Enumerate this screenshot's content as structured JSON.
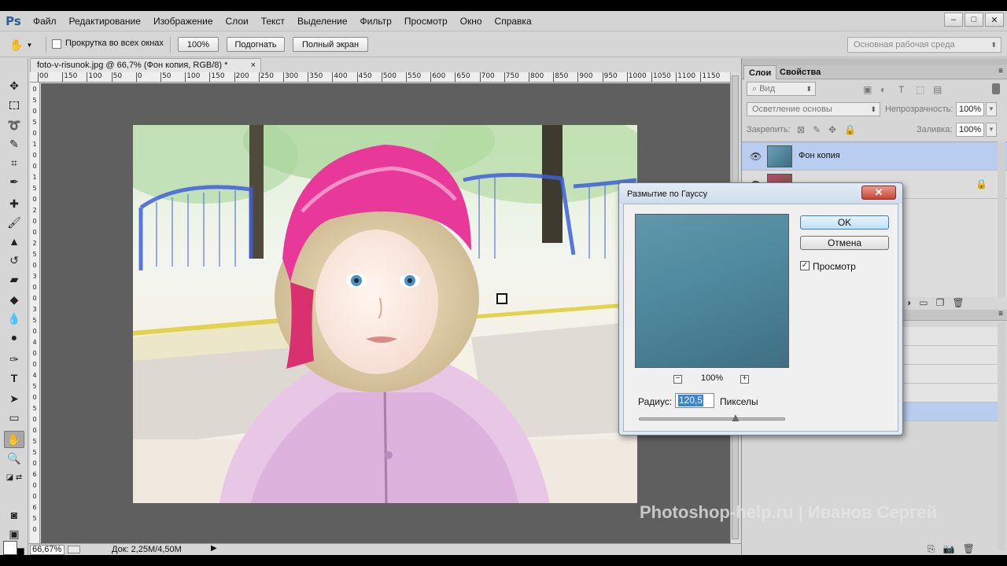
{
  "app": {
    "logo": "Ps",
    "menu": [
      "Файл",
      "Редактирование",
      "Изображение",
      "Слои",
      "Текст",
      "Выделение",
      "Фильтр",
      "Просмотр",
      "Окно",
      "Справка"
    ]
  },
  "window_controls": [
    "–",
    "□",
    "✕"
  ],
  "options": {
    "scroll_all_windows": "Прокрутка во всех окнах",
    "zoom_100": "100%",
    "fit": "Подогнать",
    "full_screen": "Полный экран",
    "workspace": "Основная рабочая среда"
  },
  "document": {
    "tab_title": "foto-v-risunok.jpg @ 66,7% (Фон копия, RGB/8) *",
    "close": "×",
    "ruler_h": [
      "00",
      "150",
      "100",
      "50",
      "0",
      "50",
      "100",
      "150",
      "200",
      "250",
      "300",
      "350",
      "400",
      "450",
      "500",
      "550",
      "600",
      "650",
      "700",
      "750",
      "800",
      "850",
      "900",
      "950",
      "1000",
      "1050",
      "1100",
      "1150"
    ],
    "ruler_v": [
      "0",
      "5",
      "0",
      "5",
      "0",
      "1",
      "0",
      "0",
      "1",
      "5",
      "0",
      "2",
      "0",
      "0",
      "2",
      "5",
      "0",
      "3",
      "0",
      "0",
      "3",
      "5",
      "0",
      "4",
      "0",
      "0",
      "4",
      "5",
      "0",
      "5",
      "0",
      "0",
      "5",
      "5",
      "0",
      "6",
      "0",
      "0",
      "6",
      "5",
      "0"
    ]
  },
  "status": {
    "zoom": "66,67%",
    "doc_info": "Док: 2,25M/4,50M",
    "arrow": "▶"
  },
  "panels": {
    "tabs": [
      "Слои",
      "Свойства"
    ],
    "filter_kind": "Вид",
    "blend_mode": "Осветление основы",
    "opacity_label": "Непрозрачность:",
    "opacity_value": "100%",
    "lock_label": "Закрепить:",
    "fill_label": "Заливка:",
    "fill_value": "100%",
    "layers": [
      {
        "name": "Фон копия",
        "selected": true,
        "visible": true
      },
      {
        "name": "",
        "selected": false,
        "visible": true,
        "locked": true
      }
    ]
  },
  "dialog": {
    "title": "Размытие по Гауссу",
    "close": "✕",
    "ok": "OK",
    "cancel": "Отмена",
    "preview_label": "Просмотр",
    "preview_checked": true,
    "zoom_value": "100%",
    "zoom_minus": "−",
    "zoom_plus": "+",
    "radius_label": "Радиус:",
    "radius_value": "120,5",
    "radius_unit": "Пикселы",
    "slider_fraction": 0.66
  },
  "watermark": "Photoshop-help.ru | Иванов Сергей",
  "icons": {
    "tools": [
      "move-icon",
      "marquee-icon",
      "lasso-icon",
      "quick-select-icon",
      "crop-icon",
      "eyedropper-icon",
      "healing-icon",
      "brush-icon",
      "stamp-icon",
      "history-brush-icon",
      "eraser-icon",
      "gradient-icon",
      "blur-icon",
      "dodge-icon",
      "pen-icon",
      "type-icon",
      "path-select-icon",
      "shape-icon",
      "hand-icon",
      "zoom-icon"
    ]
  },
  "colors": {
    "selection_blue": "#b8cdf0",
    "preview_teal": "#4f899f",
    "menu_bg": "#d4d4d4"
  }
}
